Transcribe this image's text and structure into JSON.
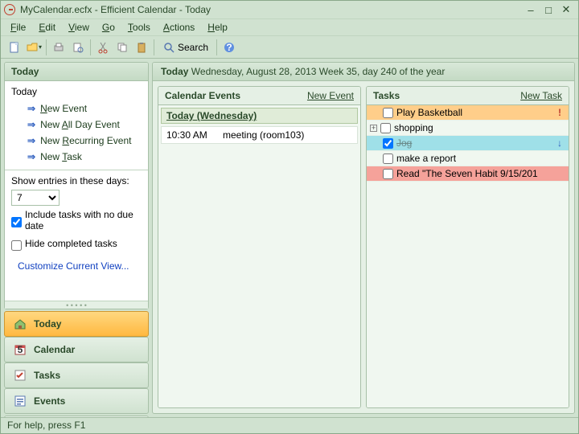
{
  "window": {
    "title": "MyCalendar.ecfx - Efficient Calendar - Today"
  },
  "menu": [
    "File",
    "Edit",
    "View",
    "Go",
    "Tools",
    "Actions",
    "Help"
  ],
  "toolbar": {
    "search_label": "Search"
  },
  "sidebar": {
    "panel_title": "Today",
    "today_label": "Today",
    "actions": [
      {
        "label": "New Event",
        "accel": "N"
      },
      {
        "label": "New All Day Event",
        "accel": "A"
      },
      {
        "label": "New Recurring Event",
        "accel": "R"
      },
      {
        "label": "New Task",
        "accel": "T"
      }
    ],
    "show_entries_label": "Show entries in these days:",
    "days_value": "7",
    "include_tasks": {
      "checked": true,
      "label": "Include tasks with no due date"
    },
    "hide_completed": {
      "checked": false,
      "label": "Hide completed tasks"
    },
    "customize_label": "Customize Current View...",
    "nav": [
      {
        "key": "today",
        "label": "Today",
        "active": true
      },
      {
        "key": "calendar",
        "label": "Calendar",
        "active": false
      },
      {
        "key": "tasks",
        "label": "Tasks",
        "active": false
      },
      {
        "key": "events",
        "label": "Events",
        "active": false
      }
    ]
  },
  "main": {
    "title_bold": "Today",
    "title_rest": "Wednesday, August 28, 2013  Week 35, day 240 of the year",
    "calendar": {
      "title": "Calendar Events",
      "new_label": "New Event",
      "day_header": "Today (Wednesday)",
      "events": [
        {
          "time": "10:30 AM",
          "title": "meeting (room103)"
        }
      ]
    },
    "tasks": {
      "title": "Tasks",
      "new_label": "New Task",
      "items": [
        {
          "text": "Play Basketball",
          "checked": false,
          "bg": "bg-orange",
          "flag": "!",
          "flagColor": "#c04030",
          "expander": ""
        },
        {
          "text": "shopping",
          "checked": false,
          "bg": "",
          "flag": "",
          "expander": "+"
        },
        {
          "text": "Jog",
          "checked": true,
          "bg": "bg-cyan",
          "flag": "↓",
          "flagColor": "#3060c0",
          "expander": "",
          "strike": true
        },
        {
          "text": "make a report",
          "checked": false,
          "bg": "",
          "flag": "",
          "expander": ""
        },
        {
          "text": "Read \"The Seven Habit 9/15/201",
          "checked": false,
          "bg": "bg-pink",
          "flag": "",
          "expander": ""
        }
      ]
    }
  },
  "status": {
    "text": "For help, press F1"
  },
  "colors": {
    "accent": "#3060c0"
  }
}
